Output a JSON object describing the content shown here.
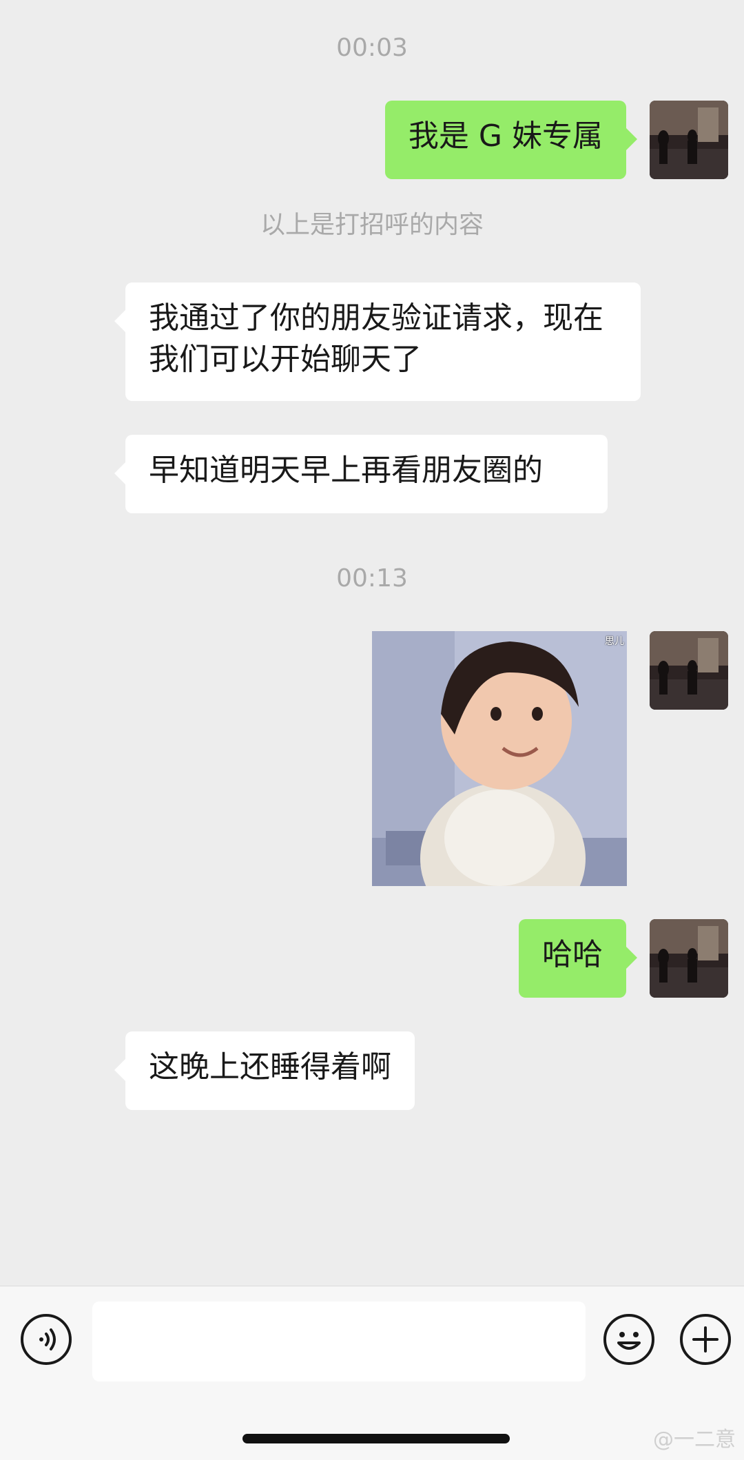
{
  "messages": {
    "time_1": "00:03",
    "out_1": "我是 G 妹专属",
    "system_note": "以上是打招呼的内容",
    "in_1": "我通过了你的朋友验证请求，现在我们可以开始聊天了",
    "in_2": "早知道明天早上再看朋友圈的",
    "time_2": "00:13",
    "sticker_watermark": "思儿",
    "out_2": "哈哈",
    "in_3": "这晚上还睡得着啊"
  },
  "input": {
    "value": "",
    "placeholder": ""
  },
  "icons": {
    "voice": "voice-icon",
    "emoji": "emoji-icon",
    "plus": "plus-icon"
  },
  "watermark": "@一二意",
  "colors": {
    "background": "#ededed",
    "outgoing_bubble": "#95ec69",
    "incoming_bubble": "#ffffff",
    "timestamp_text": "#a9a9a9"
  }
}
